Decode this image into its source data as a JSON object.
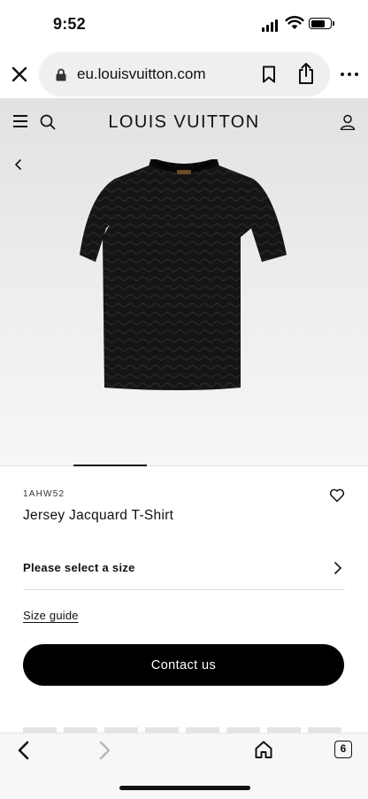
{
  "status_bar": {
    "time": "9:52"
  },
  "browser": {
    "url": "eu.louisvuitton.com",
    "tab_count": "6"
  },
  "site": {
    "brand": "LOUIS VUITTON"
  },
  "product": {
    "sku": "1AHW52",
    "name": "Jersey Jacquard T-Shirt",
    "size_prompt": "Please select a size",
    "size_guide_label": "Size guide",
    "contact_label": "Contact us",
    "image_carousel": {
      "current_index": 2,
      "total": 5
    }
  },
  "icons": {
    "close": "close-icon",
    "lock": "lock-icon",
    "bookmark": "bookmark-icon",
    "share": "share-icon",
    "more": "more-icon",
    "menu": "hamburger-icon",
    "search": "search-icon",
    "account": "user-icon",
    "favorite": "heart-icon"
  },
  "colors": {
    "primary_button": "#000000",
    "primary_button_text": "#ffffff",
    "product_background": "#ececec"
  }
}
